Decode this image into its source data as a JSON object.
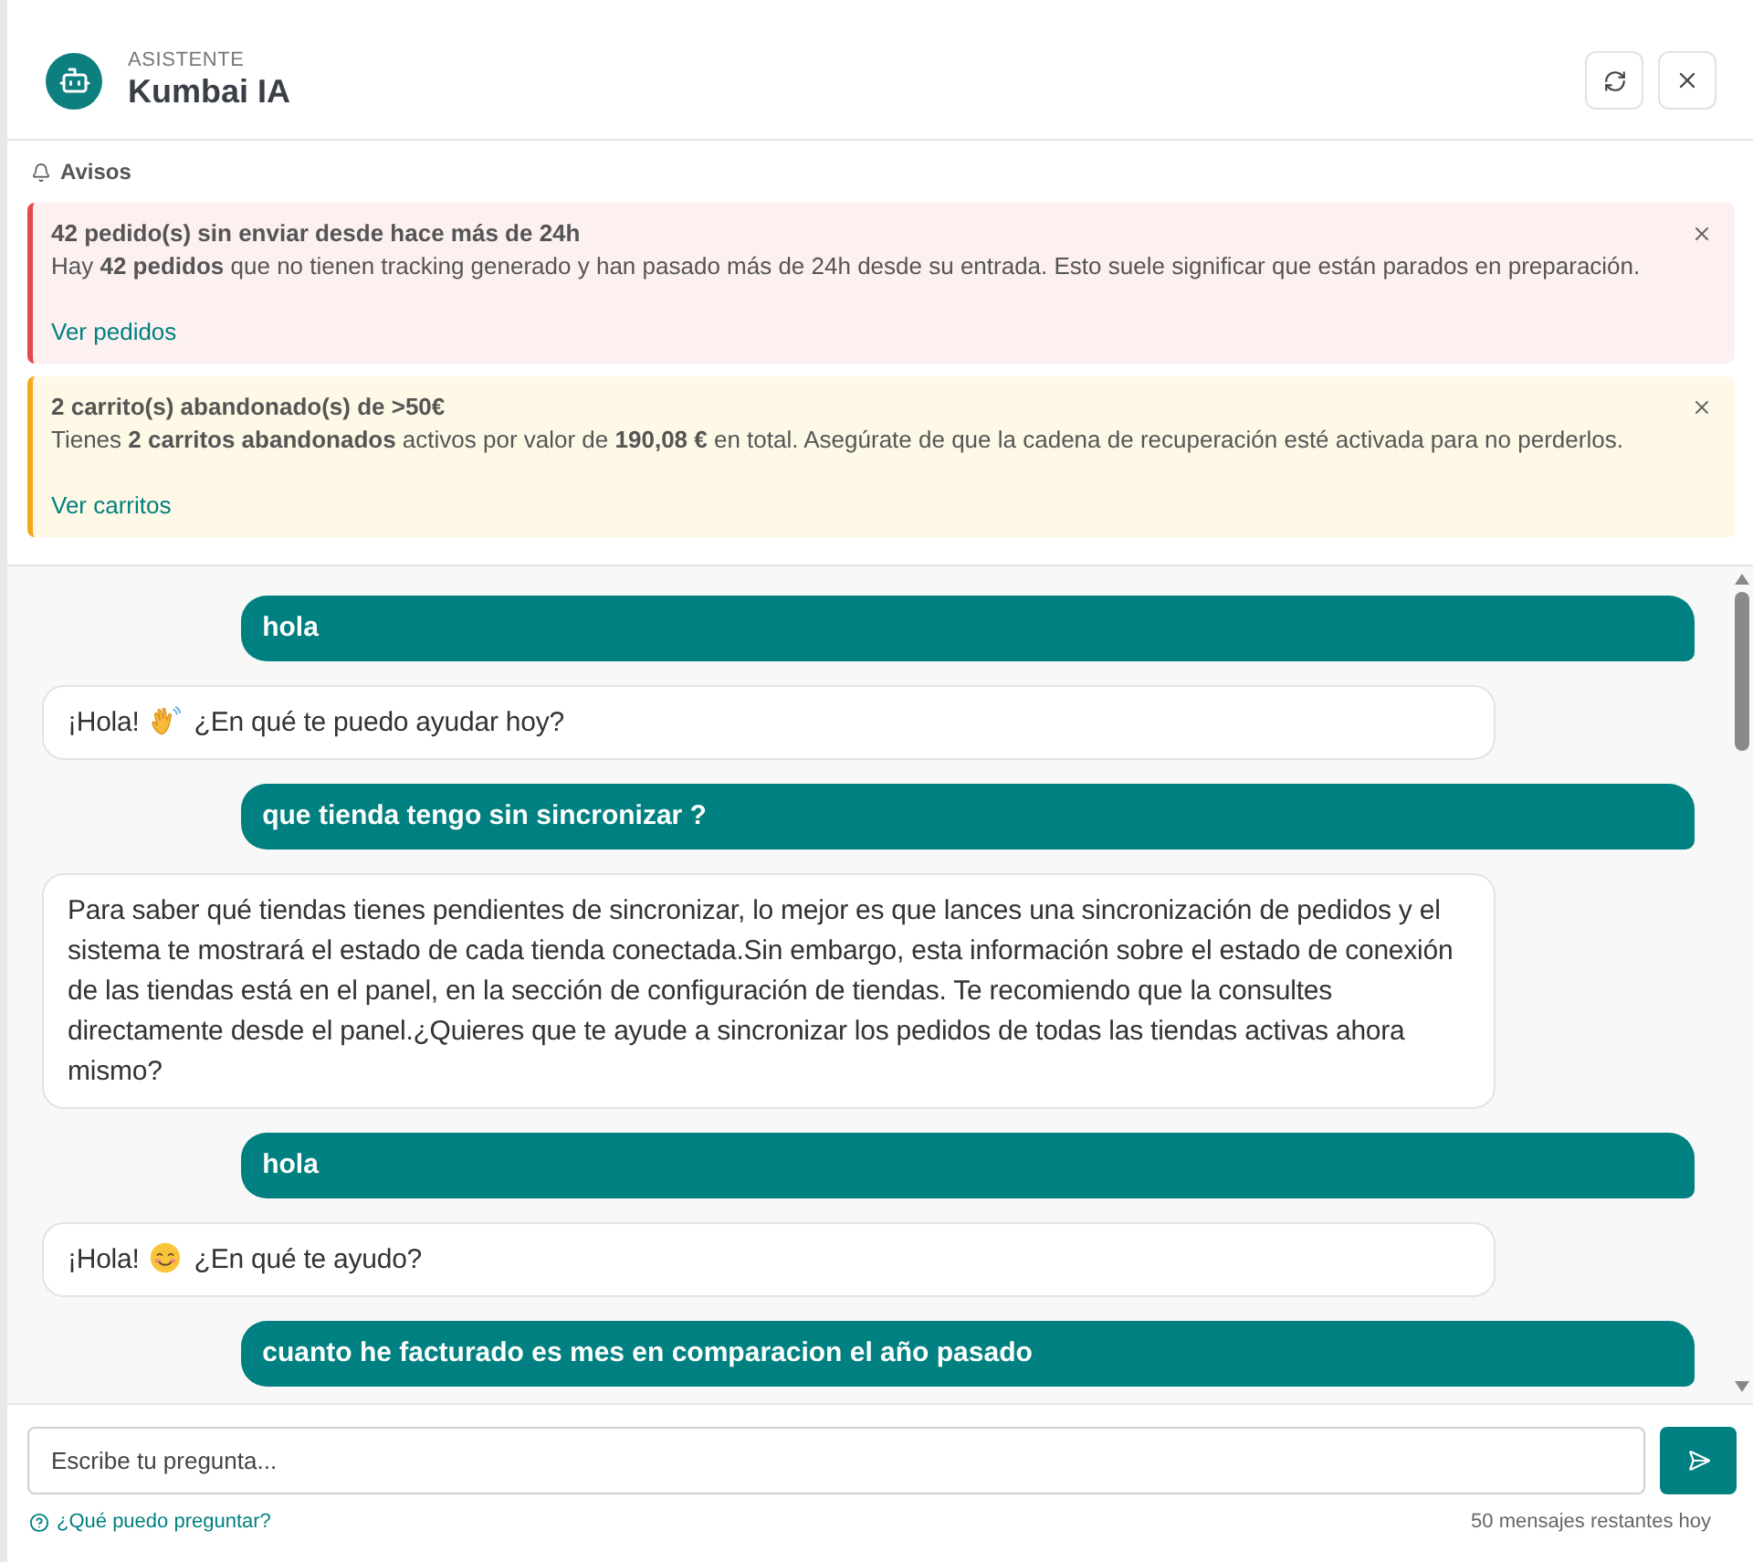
{
  "header": {
    "eyebrow": "ASISTENTE",
    "title": "Kumbai IA"
  },
  "notices": {
    "heading": "Avisos",
    "items": [
      {
        "kind": "error",
        "title": "42 pedido(s) sin enviar desde hace más de 24h",
        "body": "Hay **42 pedidos** que no tienen tracking generado y han pasado más de 24h desde su entrada. Esto suele significar que están parados en preparación.",
        "link": "Ver pedidos"
      },
      {
        "kind": "warning",
        "title": "2 carrito(s) abandonado(s) de >50€",
        "body": "Tienes **2 carritos abandonados** activos por valor de **190,08 €** en total. Asegúrate de que la cadena de recuperación esté activada para no perderlos.",
        "link": "Ver carritos"
      }
    ]
  },
  "messages": [
    {
      "kind": "user",
      "text": "hola"
    },
    {
      "kind": "bot",
      "parts": [
        {
          "kind": "text",
          "text": "¡Hola!"
        },
        {
          "kind": "waving-hand"
        },
        {
          "kind": "text",
          "text": "¿En qué te puedo ayudar hoy?"
        }
      ]
    },
    {
      "kind": "user",
      "text": "que tienda tengo sin sincronizar ?"
    },
    {
      "kind": "bot",
      "parts": [
        {
          "kind": "text",
          "text": "Para saber qué tiendas tienes pendientes de sincronizar, lo mejor es que lances una sincronización de pedidos y el sistema te mostrará el estado de cada tienda conectada.Sin embargo, esta información sobre el estado de conexión de las tiendas está en el panel, en la sección de configuración de tiendas. Te recomiendo que la consultes directamente desde el panel.¿Quieres que te ayude a sincronizar los pedidos de todas las tiendas activas ahora mismo?"
        }
      ]
    },
    {
      "kind": "user",
      "text": "hola"
    },
    {
      "kind": "bot",
      "parts": [
        {
          "kind": "text",
          "text": "¡Hola!"
        },
        {
          "kind": "smiling-face"
        },
        {
          "kind": "text",
          "text": "¿En qué te ayudo?"
        }
      ]
    },
    {
      "kind": "user",
      "text": "cuanto he facturado es mes en comparacion el año pasado"
    }
  ],
  "composer": {
    "placeholder": "Escribe tu pregunta..."
  },
  "footer": {
    "help_link": "¿Qué puedo preguntar?",
    "remaining": "50 mensajes restantes hoy"
  }
}
